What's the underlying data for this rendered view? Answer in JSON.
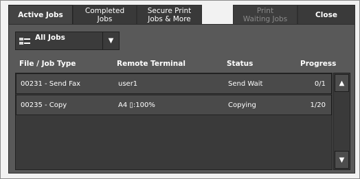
{
  "tabs": [
    {
      "label": "Active Jobs",
      "state": "active"
    },
    {
      "label": "Completed\nJobs",
      "state": "normal"
    },
    {
      "label": "Secure Print\nJobs & More",
      "state": "normal"
    },
    {
      "label": "Print\nWaiting Jobs",
      "state": "disabled"
    },
    {
      "label": "Close",
      "state": "close"
    }
  ],
  "filter": {
    "selected": "All Jobs"
  },
  "columns": {
    "file_job_type": "File / Job Type",
    "remote_terminal": "Remote Terminal",
    "status": "Status",
    "progress": "Progress"
  },
  "rows": [
    {
      "file": "00231 - Send Fax",
      "remote": "user1",
      "status": "Send Wait",
      "progress": "0/1"
    },
    {
      "file": "00235 - Copy",
      "remote": "A4 ▯:100%",
      "status": "Copying",
      "progress": "1/20"
    }
  ],
  "icons": {
    "dropdown_arrow": "triangle-down-icon",
    "scroll_up": "triangle-up-icon",
    "scroll_down": "triangle-down-icon"
  }
}
